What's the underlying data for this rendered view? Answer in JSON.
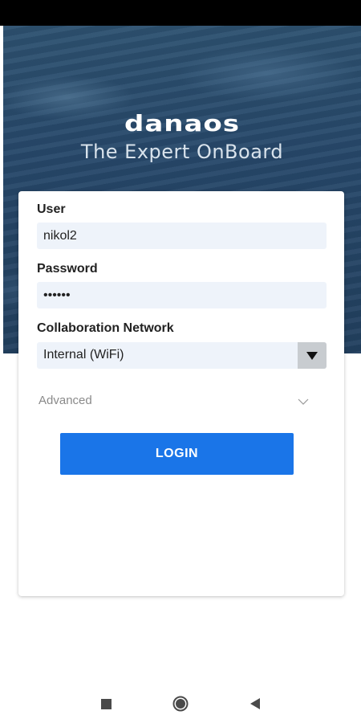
{
  "hero": {
    "logo_text": "danaos",
    "tagline": "The Expert OnBoard"
  },
  "form": {
    "user_label": "User",
    "user_value": "nikol2",
    "password_label": "Password",
    "password_value": "••••••",
    "network_label": "Collaboration Network",
    "network_selected": "Internal (WiFi)",
    "advanced_label": "Advanced",
    "login_label": "LOGIN"
  },
  "colors": {
    "accent": "#1a75e8",
    "field_bg": "#eef3fa",
    "hero_blue": "#27486a"
  },
  "icons": {
    "dropdown": "caret-down-icon",
    "advanced": "chevron-down-icon",
    "nav_recents": "square-icon",
    "nav_home": "circle-icon",
    "nav_back": "triangle-left-icon"
  }
}
